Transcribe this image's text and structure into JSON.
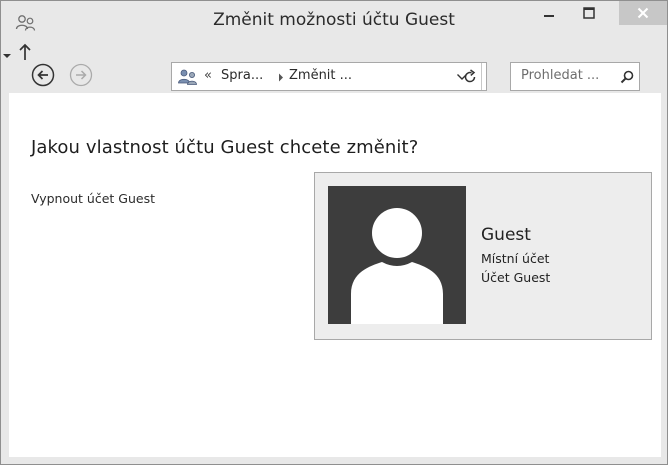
{
  "window": {
    "title": "Změnit možnosti účtu Guest",
    "icons": [
      "users-icon",
      "minimize-icon",
      "maximize-icon",
      "close-icon"
    ]
  },
  "toolbar": {
    "icons": [
      "back-arrow-icon",
      "forward-arrow-icon",
      "dropdown-icon",
      "up-arrow-icon",
      "refresh-icon"
    ],
    "address": {
      "chevron": "«",
      "crumbs": [
        "Spra...",
        "Změnit ..."
      ]
    },
    "search": {
      "placeholder": "Prohledat ..."
    }
  },
  "content": {
    "heading": "Jakou vlastnost účtu Guest chcete změnit?",
    "link": "Vypnout účet Guest",
    "account": {
      "name": "Guest",
      "type": "Místní účet",
      "description": "Účet Guest"
    }
  },
  "colors": {
    "chrome": "#e8e8e8",
    "close_button": "#c7c7c7",
    "avatar_bg": "#3d3d3d",
    "card_bg": "#ededed"
  }
}
